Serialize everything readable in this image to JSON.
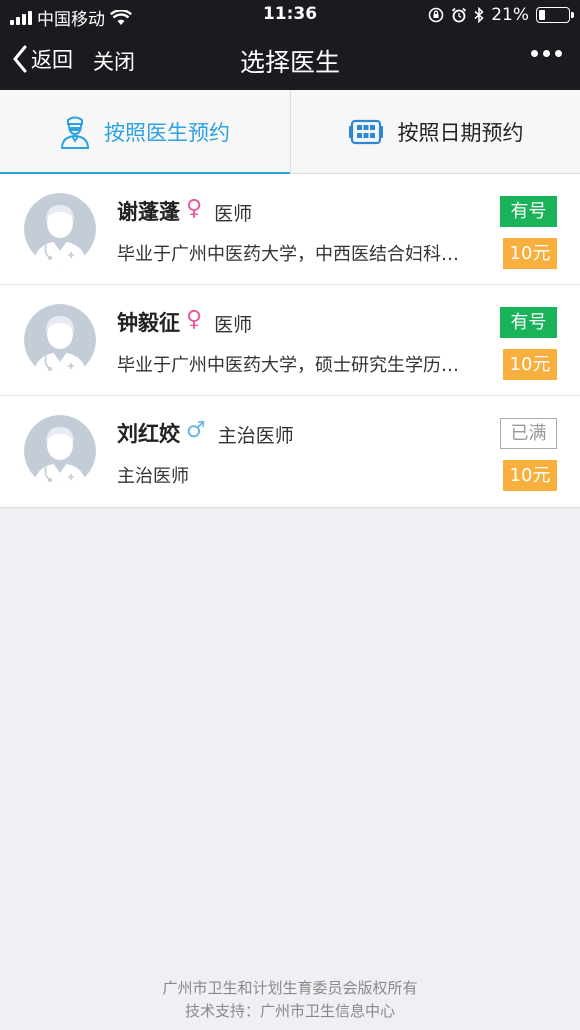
{
  "status_bar": {
    "carrier": "中国移动",
    "time": "11:36",
    "battery": "21%",
    "battery_level": 0.21
  },
  "nav": {
    "back_label": "返回",
    "close_label": "关闭",
    "title": "选择医生"
  },
  "tabs": [
    {
      "label": "按照医生预约",
      "icon": "doctor-icon",
      "active": true
    },
    {
      "label": "按照日期预约",
      "icon": "calendar-icon",
      "active": false
    }
  ],
  "doctors": [
    {
      "name": "谢蓬蓬",
      "gender_symbol": "♀",
      "title": "医师",
      "description": "毕业于广州中医药大学，中西医结合妇科…",
      "status": "有号",
      "price": "10元"
    },
    {
      "name": "钟毅征",
      "gender_symbol": "♀",
      "title": "医师",
      "description": "毕业于广州中医药大学，硕士研究生学历…",
      "status": "有号",
      "price": "10元"
    },
    {
      "name": "刘红姣",
      "gender_symbol": "♂",
      "title": "主治医师",
      "description": "主治医师",
      "status": "已满",
      "price": "10元"
    }
  ],
  "footer": {
    "line1": "广州市卫生和计划生育委员会版权所有",
    "line2": "技术支持：广州市卫生信息中心"
  },
  "colors": {
    "accent": "#2da2e0",
    "available": "#1ab35a",
    "price": "#f7b03e",
    "female": "#ea5a9b",
    "male": "#66b6e9",
    "header": "#1a1a1f"
  }
}
